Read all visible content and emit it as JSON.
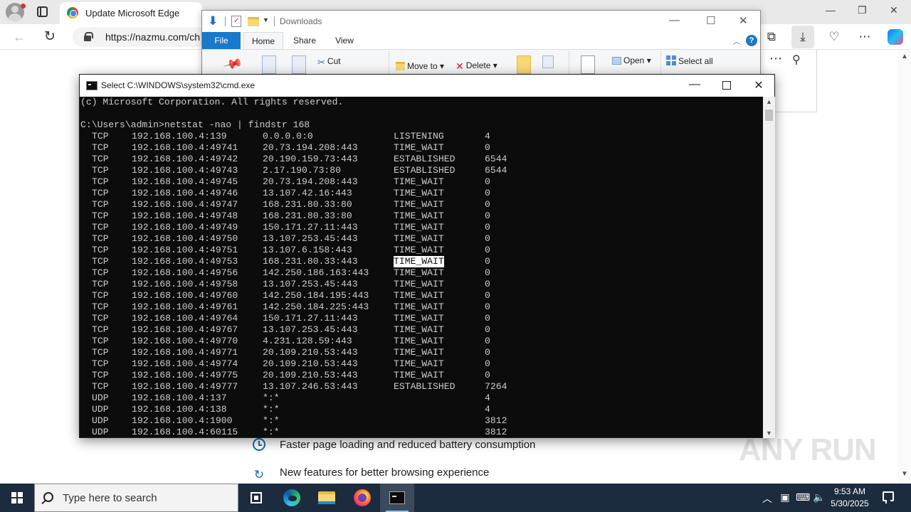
{
  "edge": {
    "tab_title": "Update Microsoft Edge",
    "url": "https://nazmu.com/ch",
    "features": [
      {
        "text": "Faster page loading and reduced battery consumption",
        "icon": "clock-icon"
      },
      {
        "text": "New features for better browsing experience",
        "icon": "refresh-icon"
      }
    ],
    "watermark": "ANY RUN"
  },
  "explorer": {
    "title": "Downloads",
    "tabs": {
      "file": "File",
      "home": "Home",
      "share": "Share",
      "view": "View"
    },
    "ribbon": {
      "cut": "Cut",
      "move_to": "Move to",
      "delete": "Delete",
      "open": "Open",
      "select_all": "Select all"
    },
    "help": "?"
  },
  "cmd": {
    "title": "Select C:\\WINDOWS\\system32\\cmd.exe",
    "copyright": "(c) Microsoft Corporation. All rights reserved.",
    "command": "C:\\Users\\admin>netstat -nao | findstr 168",
    "rows": [
      [
        "TCP",
        "192.168.100.4:139",
        "0.0.0.0:0",
        "LISTENING",
        "4"
      ],
      [
        "TCP",
        "192.168.100.4:49741",
        "20.73.194.208:443",
        "TIME_WAIT",
        "0"
      ],
      [
        "TCP",
        "192.168.100.4:49742",
        "20.190.159.73:443",
        "ESTABLISHED",
        "6544"
      ],
      [
        "TCP",
        "192.168.100.4:49743",
        "2.17.190.73:80",
        "ESTABLISHED",
        "6544"
      ],
      [
        "TCP",
        "192.168.100.4:49745",
        "20.73.194.208:443",
        "TIME_WAIT",
        "0"
      ],
      [
        "TCP",
        "192.168.100.4:49746",
        "13.107.42.16:443",
        "TIME_WAIT",
        "0"
      ],
      [
        "TCP",
        "192.168.100.4:49747",
        "168.231.80.33:80",
        "TIME_WAIT",
        "0"
      ],
      [
        "TCP",
        "192.168.100.4:49748",
        "168.231.80.33:80",
        "TIME_WAIT",
        "0"
      ],
      [
        "TCP",
        "192.168.100.4:49749",
        "150.171.27.11:443",
        "TIME_WAIT",
        "0"
      ],
      [
        "TCP",
        "192.168.100.4:49750",
        "13.107.253.45:443",
        "TIME_WAIT",
        "0"
      ],
      [
        "TCP",
        "192.168.100.4:49751",
        "13.107.6.158:443",
        "TIME_WAIT",
        "0"
      ],
      [
        "TCP",
        "192.168.100.4:49753",
        "168.231.80.33:443",
        "TIME_WAIT",
        "0"
      ],
      [
        "TCP",
        "192.168.100.4:49756",
        "142.250.186.163:443",
        "TIME_WAIT",
        "0"
      ],
      [
        "TCP",
        "192.168.100.4:49758",
        "13.107.253.45:443",
        "TIME_WAIT",
        "0"
      ],
      [
        "TCP",
        "192.168.100.4:49760",
        "142.250.184.195:443",
        "TIME_WAIT",
        "0"
      ],
      [
        "TCP",
        "192.168.100.4:49761",
        "142.250.184.225:443",
        "TIME_WAIT",
        "0"
      ],
      [
        "TCP",
        "192.168.100.4:49764",
        "150.171.27.11:443",
        "TIME_WAIT",
        "0"
      ],
      [
        "TCP",
        "192.168.100.4:49767",
        "13.107.253.45:443",
        "TIME_WAIT",
        "0"
      ],
      [
        "TCP",
        "192.168.100.4:49770",
        "4.231.128.59:443",
        "TIME_WAIT",
        "0"
      ],
      [
        "TCP",
        "192.168.100.4:49771",
        "20.109.210.53:443",
        "TIME_WAIT",
        "0"
      ],
      [
        "TCP",
        "192.168.100.4:49774",
        "20.109.210.53:443",
        "TIME_WAIT",
        "0"
      ],
      [
        "TCP",
        "192.168.100.4:49775",
        "20.109.210.53:443",
        "TIME_WAIT",
        "0"
      ],
      [
        "TCP",
        "192.168.100.4:49777",
        "13.107.246.53:443",
        "ESTABLISHED",
        "7264"
      ],
      [
        "UDP",
        "192.168.100.4:137",
        "*:*",
        "",
        "4"
      ],
      [
        "UDP",
        "192.168.100.4:138",
        "*:*",
        "",
        "4"
      ],
      [
        "UDP",
        "192.168.100.4:1900",
        "*:*",
        "",
        "3812"
      ],
      [
        "UDP",
        "192.168.100.4:60115",
        "*:*",
        "",
        "3812"
      ]
    ],
    "selected_row": 11
  },
  "taskbar": {
    "search_placeholder": "Type here to search",
    "time": "9:53 AM",
    "date": "5/30/2025"
  }
}
